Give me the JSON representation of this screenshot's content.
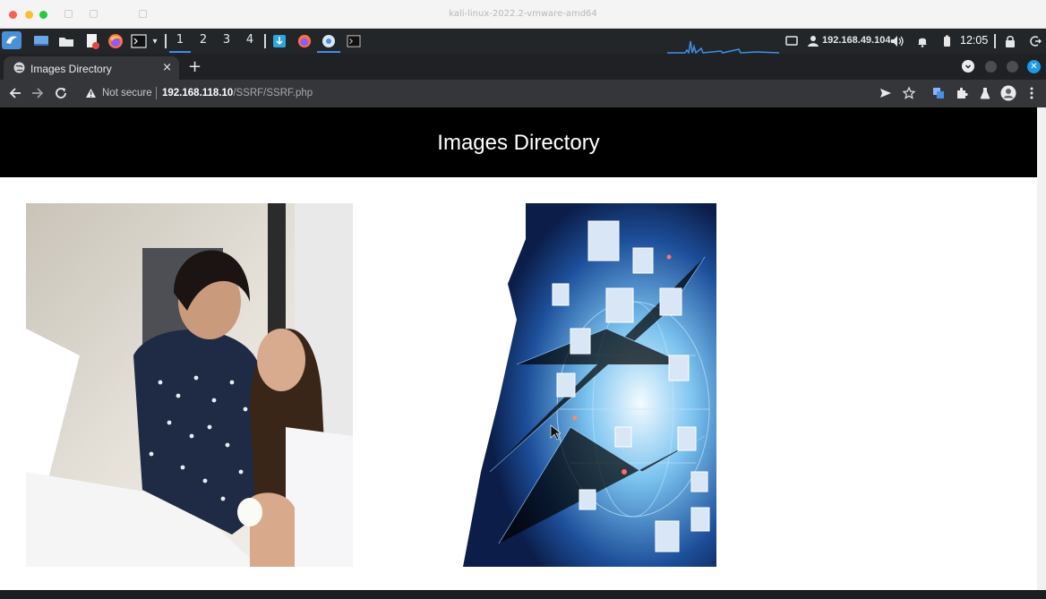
{
  "mac_window": {
    "title": "kali-linux-2022.2-vmware-amd64"
  },
  "panel": {
    "workspaces": [
      "1",
      "2",
      "3",
      "4"
    ],
    "ip_address": "192.168.49.104",
    "clock": "12:05"
  },
  "browser": {
    "tab_title": "Images Directory",
    "tab_close": "×",
    "new_tab": "+",
    "security_label": "Not secure",
    "url_host": "192.168.118.10",
    "url_path": "/SSRF/SSRF.php"
  },
  "page": {
    "heading": "Images Directory",
    "images": [
      "two-women-office-photo",
      "network-faces-globe-photo"
    ]
  },
  "colors": {
    "page_header_bg": "#000000",
    "panel_bg": "#232629",
    "chrome_bg": "#35363a",
    "accent_blue": "#3d8fe5"
  }
}
